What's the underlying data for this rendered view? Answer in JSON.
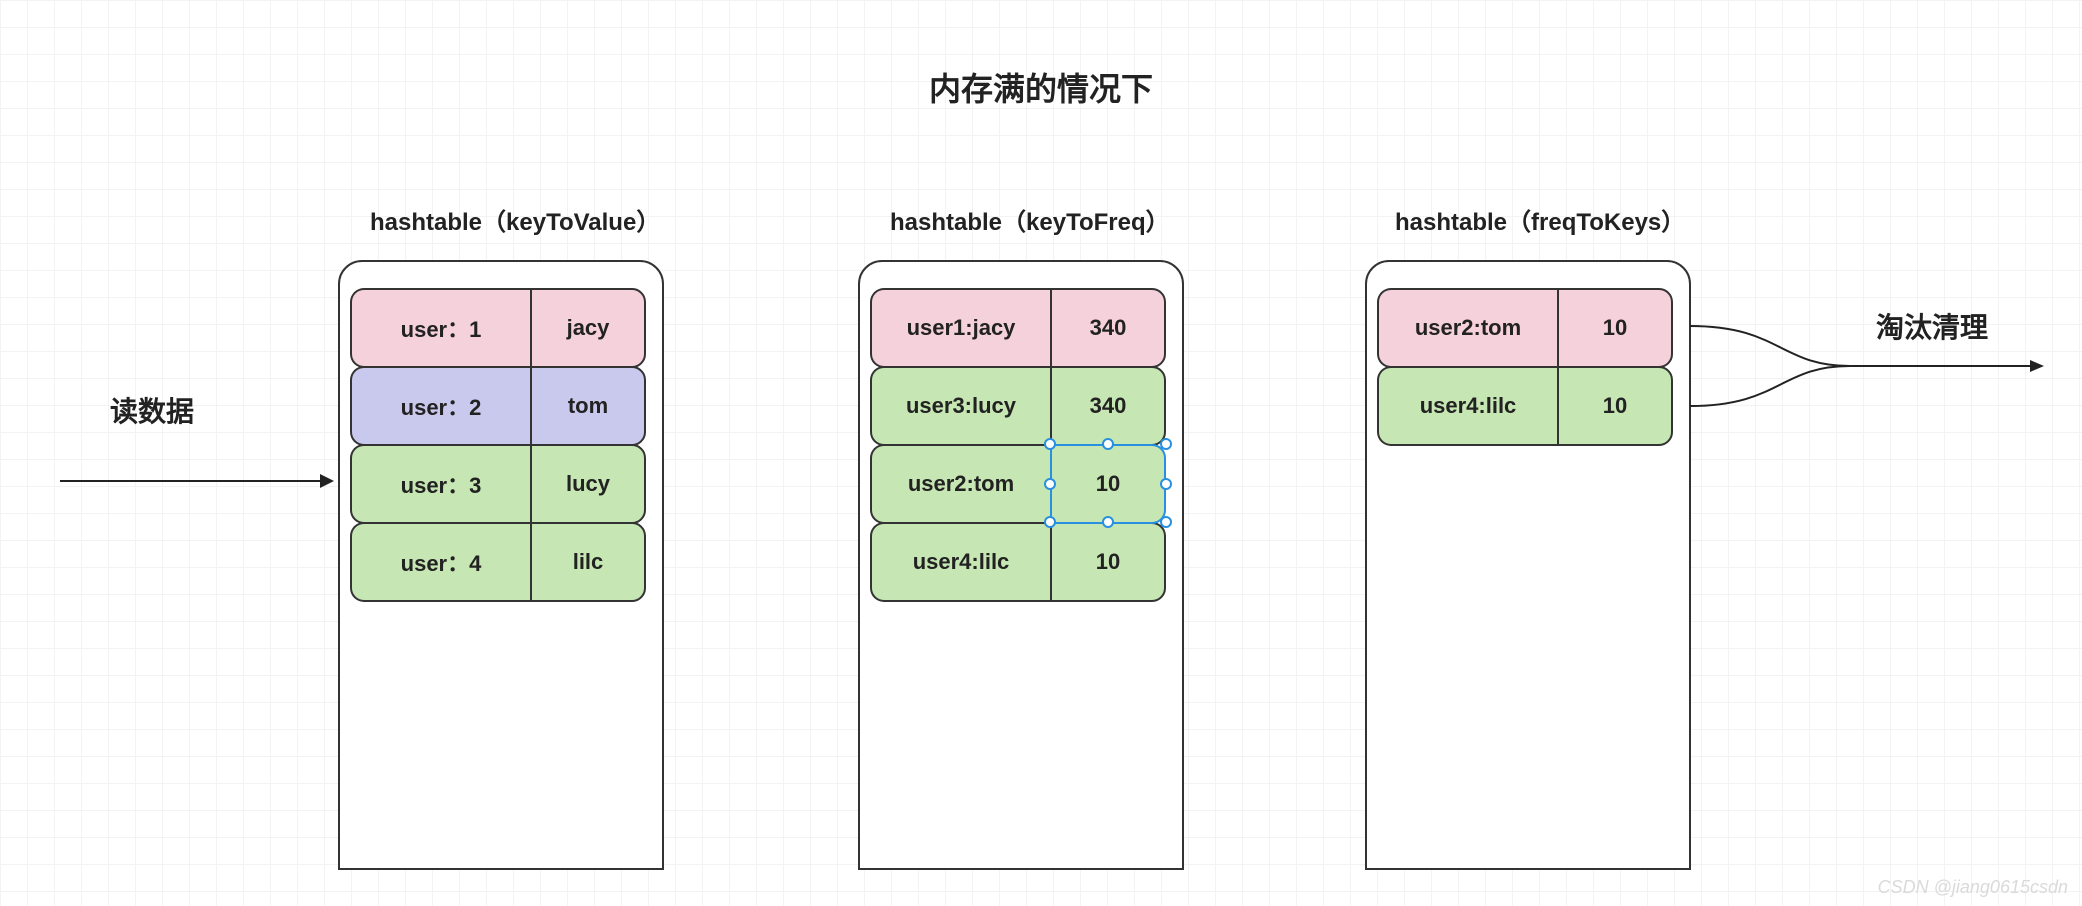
{
  "title": "内存满的情况下",
  "left_label": "读数据",
  "right_label": "淘汰清理",
  "watermark": "CSDN @jiang0615csdn",
  "tables": {
    "keyToValue": {
      "label": "hashtable（keyToValue）",
      "rows": [
        {
          "key": "user：1",
          "val": "jacy",
          "color": "pink"
        },
        {
          "key": "user：2",
          "val": "tom",
          "color": "purple"
        },
        {
          "key": "user：3",
          "val": "lucy",
          "color": "green"
        },
        {
          "key": "user：4",
          "val": "lilc",
          "color": "green"
        }
      ]
    },
    "keyToFreq": {
      "label": "hashtable（keyToFreq）",
      "rows": [
        {
          "key": "user1:jacy",
          "val": "340",
          "color": "pink"
        },
        {
          "key": "user3:lucy",
          "val": "340",
          "color": "green"
        },
        {
          "key": "user2:tom",
          "val": "10",
          "color": "green",
          "selected": true
        },
        {
          "key": "user4:lilc",
          "val": "10",
          "color": "green"
        }
      ]
    },
    "freqToKeys": {
      "label": "hashtable（freqToKeys）",
      "rows": [
        {
          "key": "user2:tom",
          "val": "10",
          "color": "pink"
        },
        {
          "key": "user4:lilc",
          "val": "10",
          "color": "green"
        }
      ]
    }
  }
}
